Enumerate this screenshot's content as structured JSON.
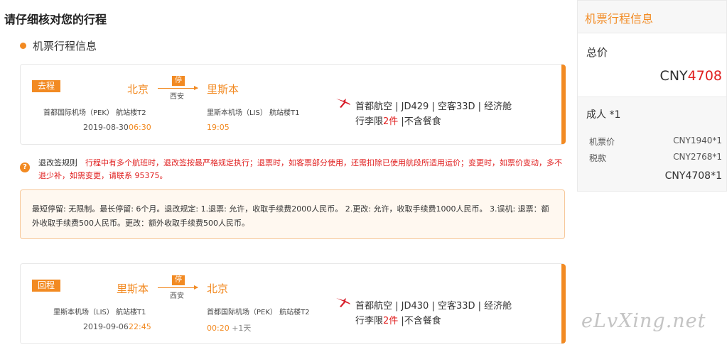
{
  "page_title": "请仔细核对您的行程",
  "section_title": "机票行程信息",
  "outbound": {
    "tag": "去程",
    "from_city": "北京",
    "to_city": "里斯本",
    "stop_badge": "停",
    "stop_city": "西安",
    "from_airport": "首都国际机场（PEK） 航站楼T2",
    "to_airport": "里斯本机场（LIS） 航站楼T1",
    "date": "2019-08-30",
    "dep_time": "06:30",
    "arr_time": "19:05",
    "arr_plus_day": "",
    "flight_info": "首都航空 | JD429 | 空客33D | 经济舱",
    "baggage_prefix": "行李限",
    "baggage_num": "2件",
    "baggage_suffix": " |不含餐食"
  },
  "return": {
    "tag": "回程",
    "from_city": "里斯本",
    "to_city": "北京",
    "stop_badge": "停",
    "stop_city": "西安",
    "from_airport": "里斯本机场（LIS） 航站楼T1",
    "to_airport": "首都国际机场（PEK） 航站楼T2",
    "date": "2019-09-06",
    "dep_time": "22:45",
    "arr_time": "00:20",
    "arr_plus_day": " +1天",
    "flight_info": "首都航空 | JD430 | 空客33D | 经济舱",
    "baggage_prefix": "行李限",
    "baggage_num": "2件",
    "baggage_suffix": " |不含餐食"
  },
  "rules": {
    "icon": "?",
    "label": "退改签规则",
    "text": "行程中有多个航班时，退改签按最严格规定执行；退票时，如客票部分使用，还需扣除已使用航段所适用运价；变更时，如票价变动，多不退少补，如需变更，请联系 95375。",
    "detail": "最短停留: 无限制。最长停留: 6个月。退改规定: 1.退票: 允许，收取手续费2000人民币。 2.更改: 允许，收取手续费1000人民币。 3.误机: 退票：额外收取手续费500人民币。更改：额外收取手续费500人民币。"
  },
  "side": {
    "title": "机票行程信息",
    "total_label": "总价",
    "currency": "CNY",
    "total_amount": "4708",
    "adult_label": "成人 *1",
    "ticket_label": "机票价",
    "ticket_value": "CNY1940*1",
    "tax_label": "税款",
    "tax_value": "CNY2768*1",
    "sum": "CNY4708*1"
  },
  "watermark": "eLvXing.net",
  "colors": {
    "accent": "#f28a22",
    "price_red": "#e02020"
  },
  "icons": {
    "airline": "capital-airlines-logo-icon",
    "rule": "question-icon"
  }
}
